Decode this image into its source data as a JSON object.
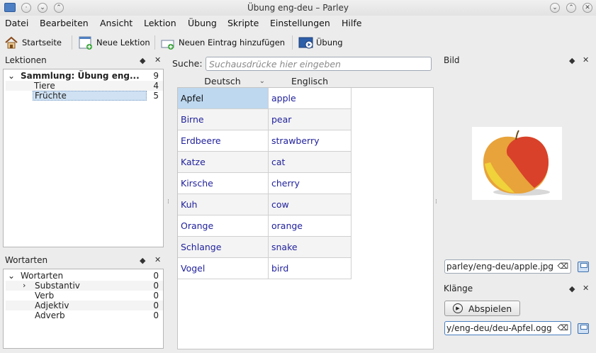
{
  "window": {
    "title": "Übung eng-deu – Parley"
  },
  "menu": [
    "Datei",
    "Bearbeiten",
    "Ansicht",
    "Lektion",
    "Übung",
    "Skripte",
    "Einstellungen",
    "Hilfe"
  ],
  "toolbar": {
    "home": "Startseite",
    "new_lesson": "Neue Lektion",
    "new_entry": "Neuen Eintrag hinzufügen",
    "practice": "Übung"
  },
  "lessons_panel": {
    "title": "Lektionen",
    "root": {
      "label": "Sammlung: Übung eng...",
      "count": "9"
    },
    "children": [
      {
        "label": "Tiere",
        "count": "4"
      },
      {
        "label": "Früchte",
        "count": "5"
      }
    ]
  },
  "wordtypes_panel": {
    "title": "Wortarten",
    "root": {
      "label": "Wortarten",
      "count": "0"
    },
    "children": [
      {
        "label": "Substantiv",
        "count": "0"
      },
      {
        "label": "Verb",
        "count": "0"
      },
      {
        "label": "Adjektiv",
        "count": "0"
      },
      {
        "label": "Adverb",
        "count": "0"
      }
    ]
  },
  "search": {
    "label": "Suche:",
    "placeholder": "Suchausdrücke hier eingeben"
  },
  "table": {
    "columns": [
      "Deutsch",
      "Englisch"
    ],
    "rows": [
      [
        "Apfel",
        "apple"
      ],
      [
        "Birne",
        "pear"
      ],
      [
        "Erdbeere",
        "strawberry"
      ],
      [
        "Katze",
        "cat"
      ],
      [
        "Kirsche",
        "cherry"
      ],
      [
        "Kuh",
        "cow"
      ],
      [
        "Orange",
        "orange"
      ],
      [
        "Schlange",
        "snake"
      ],
      [
        "Vogel",
        "bird"
      ]
    ]
  },
  "image_panel": {
    "title": "Bild",
    "path": "parley/eng-deu/apple.jpg"
  },
  "sound_panel": {
    "title": "Klänge",
    "play": "Abspielen",
    "path": "y/eng-deu/deu-Apfel.ogg"
  },
  "colors": {
    "selected_row": "#bdd8ef",
    "link_text": "#1f1f9c"
  }
}
